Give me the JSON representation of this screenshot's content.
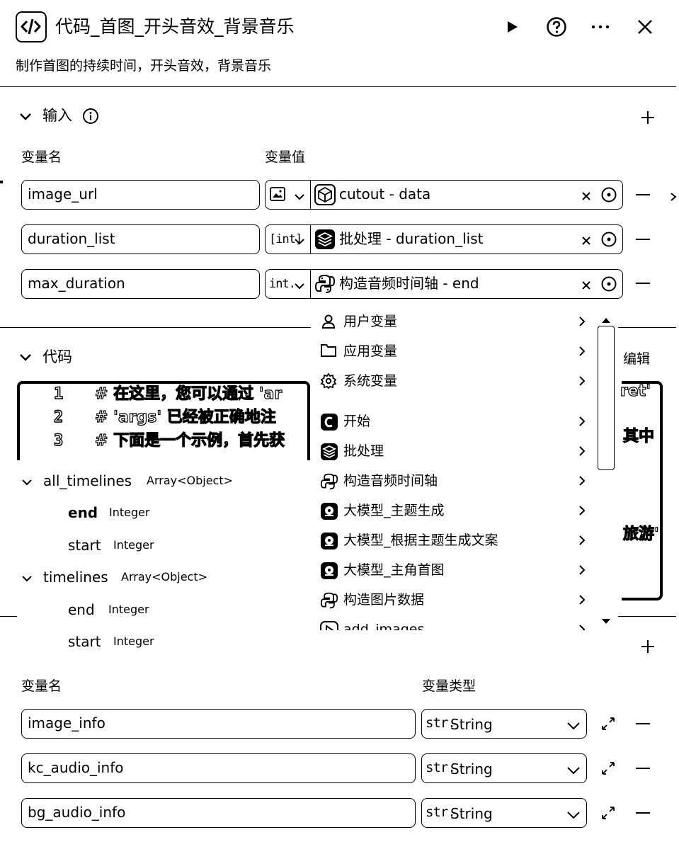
{
  "header": {
    "title": "代码_首图_开头音效_背景音乐",
    "subtitle": "制作首图的持续时间，开头音效，背景音乐"
  },
  "input_section": {
    "title": "输入",
    "col_name": "变量名",
    "col_value": "变量值",
    "rows": [
      {
        "name": "image_url",
        "type_icon": "image-type-icon",
        "type_label": "",
        "value": "cutout - data",
        "value_icon": "cube-icon"
      },
      {
        "name": "duration_list",
        "type_icon": "",
        "type_label": "[int]",
        "value": "批处理 - duration_list",
        "value_icon": "batch-icon"
      },
      {
        "name": "max_duration",
        "type_icon": "",
        "type_label": "int.",
        "value": "构造音频时间轴 - end",
        "value_icon": "python-icon"
      }
    ]
  },
  "code_section": {
    "title": "代码",
    "edit_label": "编辑",
    "lines": [
      {
        "num": "1",
        "text": "# 在这里，您可以通过 'ar"
      },
      {
        "num": "2",
        "text": "# 'args' 已经被正确地注"
      },
      {
        "num": "3",
        "text": "# 下面是一个示例，首先获"
      }
    ],
    "right_fragments": [
      "ret'",
      "其中",
      "旅游'"
    ]
  },
  "tree": {
    "groups": [
      {
        "name": "all_timelines",
        "type": "Array<Object>",
        "children": [
          {
            "name": "end",
            "type": "Integer"
          },
          {
            "name": "start",
            "type": "Integer"
          }
        ]
      },
      {
        "name": "timelines",
        "type": "Array<Object>",
        "children": [
          {
            "name": "end",
            "type": "Integer"
          },
          {
            "name": "start",
            "type": "Integer"
          }
        ]
      }
    ]
  },
  "dropdown": {
    "items": [
      {
        "label": "用户变量",
        "icon": "user-icon"
      },
      {
        "label": "应用变量",
        "icon": "folder-icon"
      },
      {
        "label": "系统变量",
        "icon": "gear-icon"
      },
      {
        "label": "开始",
        "icon": "start-icon"
      },
      {
        "label": "批处理",
        "icon": "batch-icon"
      },
      {
        "label": "构造音频时间轴",
        "icon": "python-icon"
      },
      {
        "label": "大模型_主题生成",
        "icon": "llm-icon"
      },
      {
        "label": "大模型_根据主题生成文案",
        "icon": "llm-icon"
      },
      {
        "label": "大模型_主角首图",
        "icon": "llm-icon"
      },
      {
        "label": "构造图片数据",
        "icon": "python-icon"
      },
      {
        "label": "add_images",
        "icon": "plugin-icon"
      }
    ]
  },
  "output_section": {
    "col_name": "变量名",
    "col_type": "变量类型",
    "rows": [
      {
        "name": "image_info",
        "abbr": "str.",
        "type": "String"
      },
      {
        "name": "kc_audio_info",
        "abbr": "str.",
        "type": "String"
      },
      {
        "name": "bg_audio_info",
        "abbr": "str.",
        "type": "String"
      }
    ]
  }
}
